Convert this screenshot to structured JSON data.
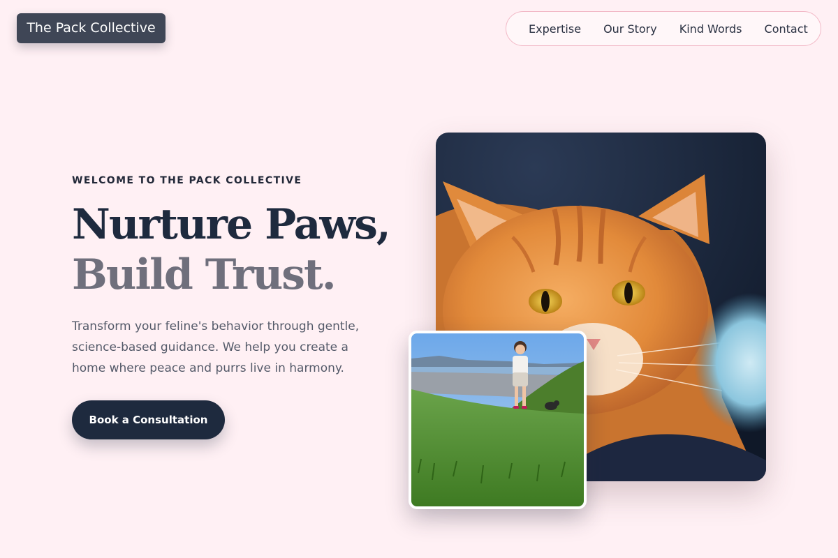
{
  "header": {
    "brand": "The Pack Collective",
    "nav": [
      "Expertise",
      "Our Story",
      "Kind Words",
      "Contact"
    ]
  },
  "hero": {
    "eyebrow": "WELCOME TO THE PACK COLLECTIVE",
    "headline_line1": "Nurture Paws,",
    "headline_line2": "Build Trust.",
    "description": "Transform your feline's behavior through gentle, science-based guidance. We help you create a home where peace and purrs live in harmony.",
    "cta_label": "Book a Consultation"
  },
  "images": {
    "main": "orange-tabby-cat-photo",
    "secondary": "child-with-small-dog-on-grassy-hill-photo"
  },
  "colors": {
    "page_background": "#fff0f4",
    "brand_background": "#3f4656",
    "primary_dark": "#1e2a3e",
    "headline_muted": "#6f6f7c",
    "nav_border": "#f2b8c6"
  }
}
